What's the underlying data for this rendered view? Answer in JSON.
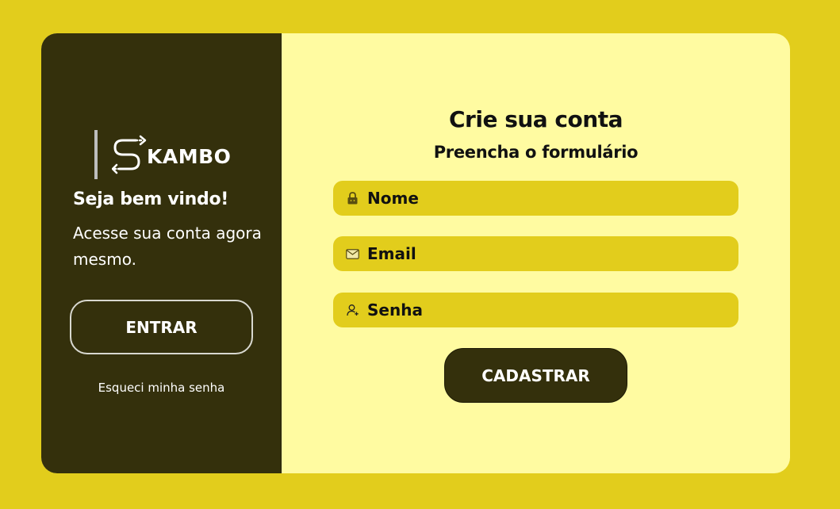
{
  "brand": {
    "name": "KAMBO"
  },
  "left_panel": {
    "welcome": "Seja bem vindo!",
    "subtitle": "Acesse sua conta agora mesmo.",
    "login_button": "ENTRAR",
    "forgot_link": "Esqueci minha senha"
  },
  "form": {
    "title": "Crie sua conta",
    "subtitle": "Preencha o formulário",
    "fields": [
      {
        "label": "Nome",
        "icon": "lock-icon"
      },
      {
        "label": "Email",
        "icon": "envelope-icon"
      },
      {
        "label": "Senha",
        "icon": "user-add-icon"
      }
    ],
    "submit_button": "CADASTRAR"
  },
  "colors": {
    "background": "#e2cd1c",
    "sidebar": "#34300c",
    "form_panel": "#fffba1",
    "field": "#e2cd1c"
  }
}
